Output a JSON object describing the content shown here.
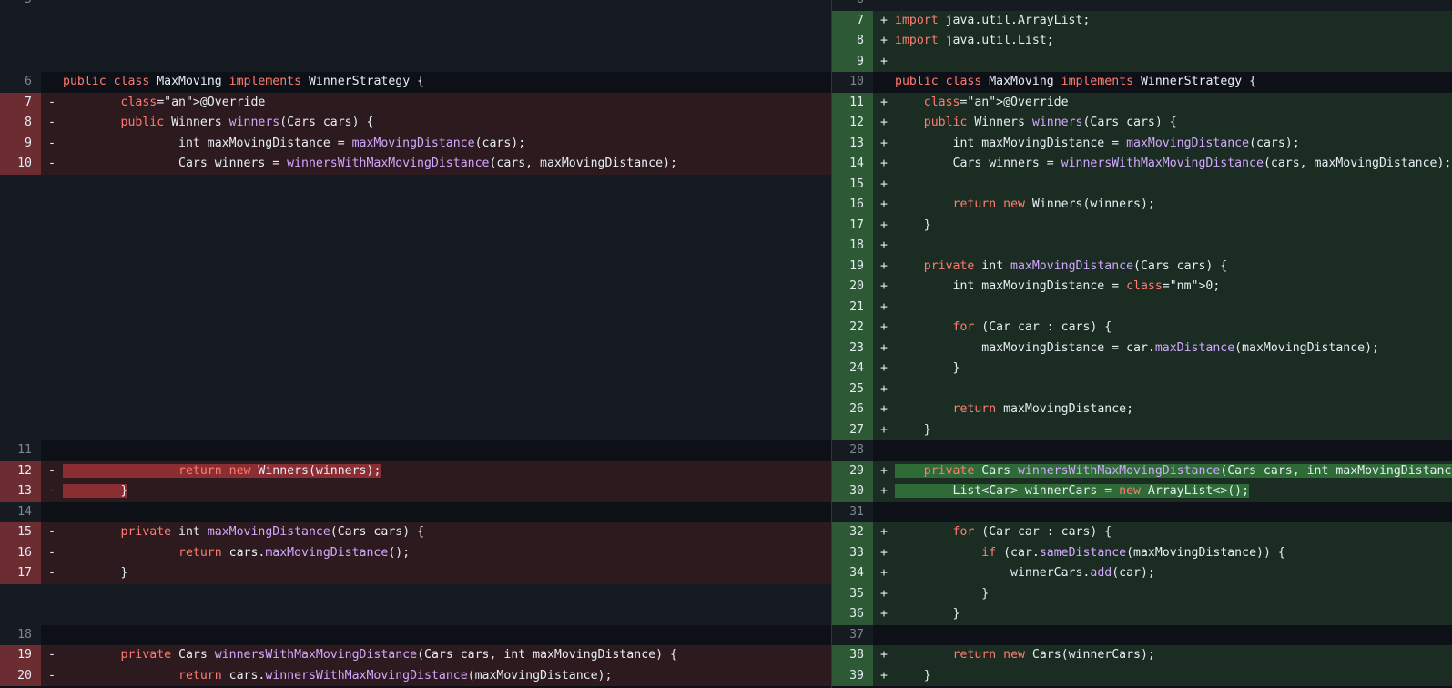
{
  "left": [
    {
      "type": "hunk",
      "num": "5",
      "sign": "",
      "code": ""
    },
    {
      "type": "empty"
    },
    {
      "type": "empty"
    },
    {
      "type": "empty"
    },
    {
      "type": "ctx",
      "num": "6",
      "sign": "",
      "code": "public class MaxMoving implements WinnerStrategy {"
    },
    {
      "type": "del",
      "num": "7",
      "sign": "-",
      "code": "        @Override"
    },
    {
      "type": "del",
      "num": "8",
      "sign": "-",
      "code": "        public Winners winners(Cars cars) {"
    },
    {
      "type": "del",
      "num": "9",
      "sign": "-",
      "code": "                int maxMovingDistance = maxMovingDistance(cars);"
    },
    {
      "type": "del",
      "num": "10",
      "sign": "-",
      "code": "                Cars winners = winnersWithMaxMovingDistance(cars, maxMovingDistance);"
    },
    {
      "type": "empty"
    },
    {
      "type": "empty"
    },
    {
      "type": "empty"
    },
    {
      "type": "empty"
    },
    {
      "type": "empty"
    },
    {
      "type": "empty"
    },
    {
      "type": "empty"
    },
    {
      "type": "empty"
    },
    {
      "type": "empty"
    },
    {
      "type": "empty"
    },
    {
      "type": "empty"
    },
    {
      "type": "empty"
    },
    {
      "type": "empty"
    },
    {
      "type": "ctx",
      "num": "11",
      "sign": "",
      "code": ""
    },
    {
      "type": "del",
      "num": "12",
      "sign": "-",
      "code": "                return new Winners(winners);",
      "hl": true
    },
    {
      "type": "del",
      "num": "13",
      "sign": "-",
      "code": "        }",
      "hl": true
    },
    {
      "type": "ctx",
      "num": "14",
      "sign": "",
      "code": ""
    },
    {
      "type": "del",
      "num": "15",
      "sign": "-",
      "code": "        private int maxMovingDistance(Cars cars) {"
    },
    {
      "type": "del",
      "num": "16",
      "sign": "-",
      "code": "                return cars.maxMovingDistance();"
    },
    {
      "type": "del",
      "num": "17",
      "sign": "-",
      "code": "        }"
    },
    {
      "type": "empty"
    },
    {
      "type": "empty"
    },
    {
      "type": "ctx",
      "num": "18",
      "sign": "",
      "code": ""
    },
    {
      "type": "del",
      "num": "19",
      "sign": "-",
      "code": "        private Cars winnersWithMaxMovingDistance(Cars cars, int maxMovingDistance) {"
    },
    {
      "type": "del",
      "num": "20",
      "sign": "-",
      "code": "                return cars.winnersWithMaxMovingDistance(maxMovingDistance);"
    }
  ],
  "right": [
    {
      "type": "hunk",
      "num": "6",
      "sign": "",
      "code": ""
    },
    {
      "type": "add",
      "num": "7",
      "sign": "+",
      "code": "import java.util.ArrayList;"
    },
    {
      "type": "add",
      "num": "8",
      "sign": "+",
      "code": "import java.util.List;"
    },
    {
      "type": "add",
      "num": "9",
      "sign": "+",
      "code": ""
    },
    {
      "type": "ctx",
      "num": "10",
      "sign": "",
      "code": "public class MaxMoving implements WinnerStrategy {"
    },
    {
      "type": "add",
      "num": "11",
      "sign": "+",
      "code": "    @Override"
    },
    {
      "type": "add",
      "num": "12",
      "sign": "+",
      "code": "    public Winners winners(Cars cars) {"
    },
    {
      "type": "add",
      "num": "13",
      "sign": "+",
      "code": "        int maxMovingDistance = maxMovingDistance(cars);"
    },
    {
      "type": "add",
      "num": "14",
      "sign": "+",
      "code": "        Cars winners = winnersWithMaxMovingDistance(cars, maxMovingDistance);"
    },
    {
      "type": "add",
      "num": "15",
      "sign": "+",
      "code": ""
    },
    {
      "type": "add",
      "num": "16",
      "sign": "+",
      "code": "        return new Winners(winners);"
    },
    {
      "type": "add",
      "num": "17",
      "sign": "+",
      "code": "    }"
    },
    {
      "type": "add",
      "num": "18",
      "sign": "+",
      "code": ""
    },
    {
      "type": "add",
      "num": "19",
      "sign": "+",
      "code": "    private int maxMovingDistance(Cars cars) {"
    },
    {
      "type": "add",
      "num": "20",
      "sign": "+",
      "code": "        int maxMovingDistance = 0;"
    },
    {
      "type": "add",
      "num": "21",
      "sign": "+",
      "code": ""
    },
    {
      "type": "add",
      "num": "22",
      "sign": "+",
      "code": "        for (Car car : cars) {"
    },
    {
      "type": "add",
      "num": "23",
      "sign": "+",
      "code": "            maxMovingDistance = car.maxDistance(maxMovingDistance);"
    },
    {
      "type": "add",
      "num": "24",
      "sign": "+",
      "code": "        }"
    },
    {
      "type": "add",
      "num": "25",
      "sign": "+",
      "code": ""
    },
    {
      "type": "add",
      "num": "26",
      "sign": "+",
      "code": "        return maxMovingDistance;"
    },
    {
      "type": "add",
      "num": "27",
      "sign": "+",
      "code": "    }"
    },
    {
      "type": "ctx",
      "num": "28",
      "sign": "",
      "code": ""
    },
    {
      "type": "add",
      "num": "29",
      "sign": "+",
      "code": "    private Cars winnersWithMaxMovingDistance(Cars cars, int maxMovingDistance) {",
      "hl": true
    },
    {
      "type": "add",
      "num": "30",
      "sign": "+",
      "code": "        List<Car> winnerCars = new ArrayList<>();",
      "hl": true
    },
    {
      "type": "ctx",
      "num": "31",
      "sign": "",
      "code": ""
    },
    {
      "type": "add",
      "num": "32",
      "sign": "+",
      "code": "        for (Car car : cars) {"
    },
    {
      "type": "add",
      "num": "33",
      "sign": "+",
      "code": "            if (car.sameDistance(maxMovingDistance)) {"
    },
    {
      "type": "add",
      "num": "34",
      "sign": "+",
      "code": "                winnerCars.add(car);"
    },
    {
      "type": "add",
      "num": "35",
      "sign": "+",
      "code": "            }"
    },
    {
      "type": "add",
      "num": "36",
      "sign": "+",
      "code": "        }"
    },
    {
      "type": "ctx",
      "num": "37",
      "sign": "",
      "code": ""
    },
    {
      "type": "add",
      "num": "38",
      "sign": "+",
      "code": "        return new Cars(winnerCars);"
    },
    {
      "type": "add",
      "num": "39",
      "sign": "+",
      "code": "    }"
    }
  ],
  "colors": {
    "deleted_line_bg": "#2d1a1e",
    "added_line_bg": "#1b2c22",
    "keyword": "#ff7b72",
    "function": "#d2a8ff",
    "annotation": "#79c0ff"
  }
}
